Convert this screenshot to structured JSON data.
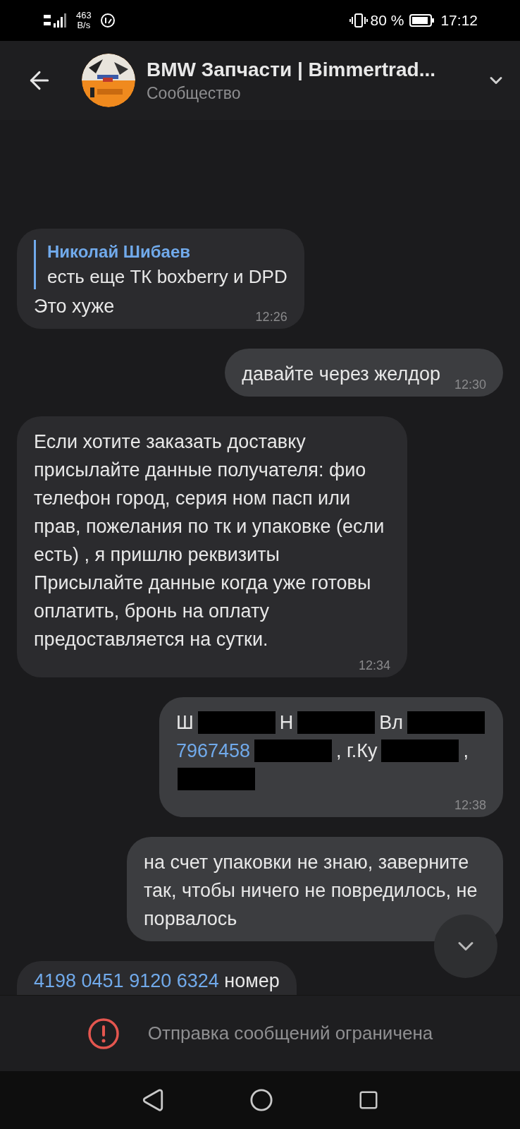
{
  "status_bar": {
    "speed_value": "463",
    "speed_unit": "B/s",
    "battery": "80 %",
    "time": "17:12"
  },
  "header": {
    "title": "BMW Запчасти | Bimmertrad...",
    "subtitle": "Сообщество"
  },
  "messages": [
    {
      "kind": "incoming",
      "reply": {
        "author": "Николай Шибаев",
        "text": "есть еще ТК boxberry и DPD"
      },
      "text": "Это хуже",
      "time": "12:26"
    },
    {
      "kind": "outgoing",
      "text": "давайте через желдор",
      "time": "12:30"
    },
    {
      "kind": "incoming",
      "text": "Если хотите заказать доставку присылайте данные получателя: фио телефон город, серия ном пасп или прав, пожелания по тк и упаковке (если есть) , я пришлю реквизиты\nПрисылайте данные когда уже готовы оплатить, бронь на оплату предоставляется на сутки.",
      "time": "12:34"
    },
    {
      "kind": "outgoing",
      "lines": [
        [
          {
            "kind": "text",
            "text": "Ш"
          },
          {
            "kind": "redacted"
          },
          {
            "kind": "text",
            "text": "Н"
          },
          {
            "kind": "redacted"
          },
          {
            "kind": "text",
            "text": "Вл"
          },
          {
            "kind": "redacted"
          }
        ],
        [
          {
            "kind": "link",
            "text": "7967458"
          },
          {
            "kind": "redacted"
          },
          {
            "kind": "text",
            "text": ", г.Ку"
          },
          {
            "kind": "redacted"
          },
          {
            "kind": "text",
            "text": ","
          }
        ],
        [
          {
            "kind": "redacted"
          }
        ]
      ],
      "time": "12:38"
    },
    {
      "kind": "outgoing",
      "text": "на счет упаковки не знаю, заверните так, чтобы ничего не повредилось, не порвалось"
    },
    {
      "kind": "incoming",
      "parts": [
        {
          "kind": "link",
          "text": "4198 0451 9120 6324"
        },
        {
          "kind": "text",
          "text": " номер"
        }
      ]
    }
  ],
  "composer": {
    "notice": "Отправка сообщений ограничена"
  }
}
